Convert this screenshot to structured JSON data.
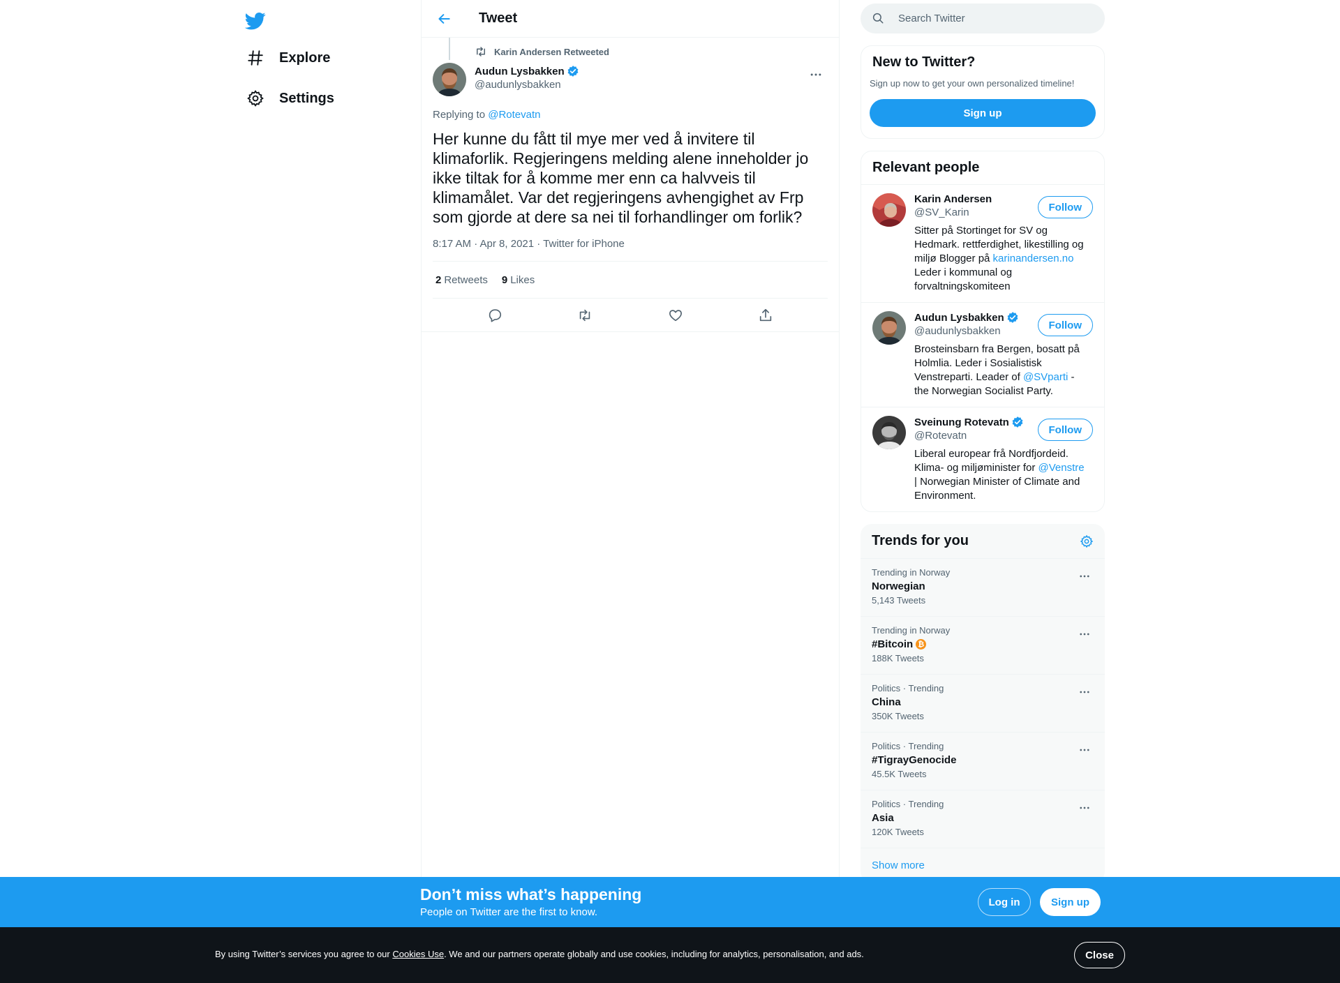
{
  "colors": {
    "accent": "#1d9bf0",
    "text": "#0f1419",
    "muted": "#536471",
    "cookie_bar": "#0f1419",
    "bitcoin": "#f7931a"
  },
  "nav": {
    "logo_icon": "twitter-bird-icon",
    "items": [
      {
        "label": "Explore",
        "icon": "hashtag-icon"
      },
      {
        "label": "Settings",
        "icon": "gear-icon"
      }
    ]
  },
  "header": {
    "back_icon": "arrow-left-icon",
    "title": "Tweet"
  },
  "tweet": {
    "retweeted_by": "Karin Andersen Retweeted",
    "author_name": "Audun Lysbakken",
    "author_handle": "@audunlysbakken",
    "verified": true,
    "replying_prefix": "Replying to",
    "replying_to": "@Rotevatn",
    "text": "Her kunne du fått til mye mer ved å invitere til klimaforlik. Regjeringens melding alene inneholder jo ikke tiltak for å komme mer enn ca halvveis til klimamålet. Var det regjeringens avhengighet av Frp som gjorde at dere sa nei til forhandlinger om forlik?",
    "meta": "8:17 AM · Apr 8, 2021 · Twitter for iPhone",
    "retweets_count": "2",
    "retweets_label": "Retweets",
    "likes_count": "9",
    "likes_label": "Likes",
    "actions": [
      "reply-icon",
      "retweet-icon",
      "like-icon",
      "share-icon"
    ]
  },
  "search": {
    "placeholder": "Search Twitter"
  },
  "new_to_twitter": {
    "title": "New to Twitter?",
    "subtitle": "Sign up now to get your own personalized timeline!",
    "button": "Sign up"
  },
  "relevant_people": {
    "title": "Relevant people",
    "follow_label": "Follow",
    "people": [
      {
        "name": "Karin Andersen",
        "handle": "@SV_Karin",
        "verified": false,
        "bio_before": "Sitter på Stortinget for SV og Hedmark. rettferdighet, likestilling og miljø Blogger på ",
        "bio_link": "karinandersen.no",
        "bio_after": " Leder i kommunal og forvaltningskomiteen"
      },
      {
        "name": "Audun Lysbakken",
        "handle": "@audunlysbakken",
        "verified": true,
        "bio_before": "Brosteinsbarn fra Bergen, bosatt på Holmlia. Leder i Sosialistisk Venstreparti. Leader of ",
        "bio_link": "@SVparti",
        "bio_after": " - the Norwegian Socialist Party."
      },
      {
        "name": "Sveinung Rotevatn",
        "handle": "@Rotevatn",
        "verified": true,
        "bio_before": "Liberal europear frå Nordfjordeid. Klima- og miljøminister for ",
        "bio_link": "@Venstre",
        "bio_after": " | Norwegian Minister of Climate and Environment."
      }
    ]
  },
  "trends": {
    "title": "Trends for you",
    "settings_icon": "gear-icon",
    "items": [
      {
        "context": "Trending in Norway",
        "name": "Norwegian",
        "count": "5,143 Tweets"
      },
      {
        "context": "Trending in Norway",
        "name": "#Bitcoin",
        "count": "188K Tweets",
        "emoji": "₿"
      },
      {
        "context": "Politics · Trending",
        "name": "China",
        "count": "350K Tweets"
      },
      {
        "context": "Politics · Trending",
        "name": "#TigrayGenocide",
        "count": "45.5K Tweets"
      },
      {
        "context": "Politics · Trending",
        "name": "Asia",
        "count": "120K Tweets"
      }
    ],
    "show_more": "Show more"
  },
  "signup_bar": {
    "headline": "Don’t miss what’s happening",
    "sub": "People on Twitter are the first to know.",
    "login": "Log in",
    "signup": "Sign up"
  },
  "cookie_bar": {
    "text_before": "By using Twitter’s services you agree to our ",
    "link": "Cookies Use",
    "text_after": ". We and our partners operate globally and use cookies, including for analytics, personalisation, and ads.",
    "close": "Close"
  }
}
